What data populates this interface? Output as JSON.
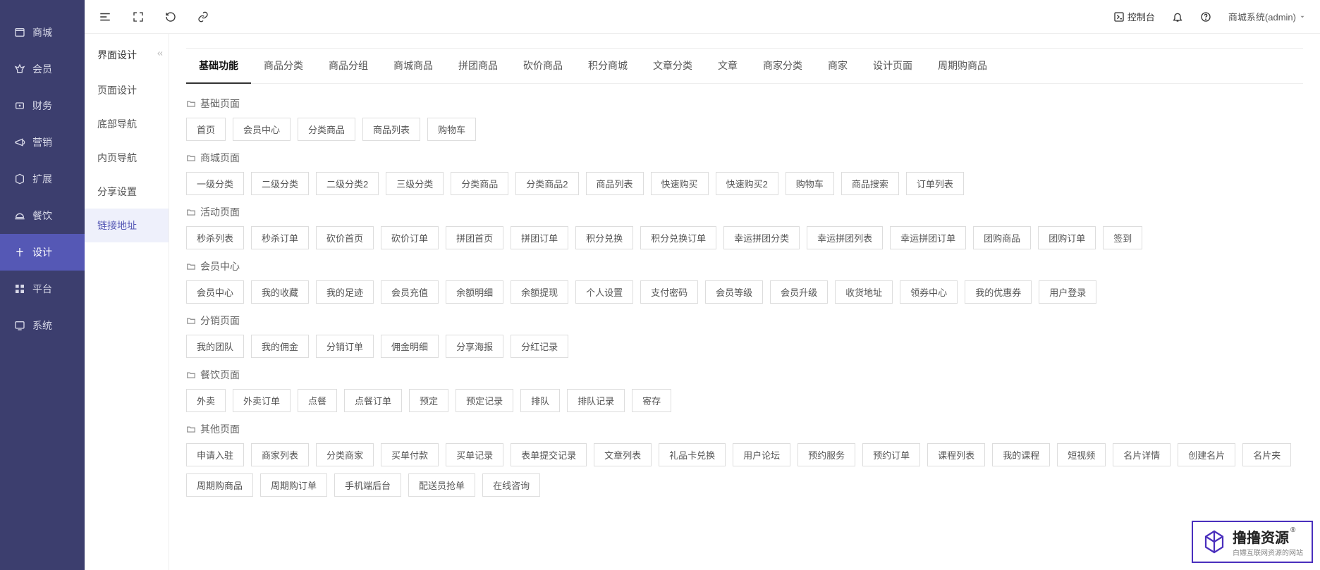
{
  "topbar": {
    "console_label": "控制台",
    "user_label": "商城系统(admin)"
  },
  "sidebar_main": {
    "items": [
      {
        "label": "商城",
        "icon": "mall-icon"
      },
      {
        "label": "会员",
        "icon": "member-icon"
      },
      {
        "label": "财务",
        "icon": "finance-icon"
      },
      {
        "label": "营销",
        "icon": "marketing-icon"
      },
      {
        "label": "扩展",
        "icon": "extension-icon"
      },
      {
        "label": "餐饮",
        "icon": "catering-icon"
      },
      {
        "label": "设计",
        "icon": "design-icon"
      },
      {
        "label": "平台",
        "icon": "platform-icon"
      },
      {
        "label": "系统",
        "icon": "system-icon"
      }
    ],
    "active_index": 6
  },
  "sidebar_sub": {
    "title": "界面设计",
    "items": [
      {
        "label": "页面设计"
      },
      {
        "label": "底部导航"
      },
      {
        "label": "内页导航"
      },
      {
        "label": "分享设置"
      },
      {
        "label": "链接地址"
      }
    ],
    "active_index": 4
  },
  "tabs": {
    "items": [
      "基础功能",
      "商品分类",
      "商品分组",
      "商城商品",
      "拼团商品",
      "砍价商品",
      "积分商城",
      "文章分类",
      "文章",
      "商家分类",
      "商家",
      "设计页面",
      "周期购商品"
    ],
    "active_index": 0
  },
  "sections": [
    {
      "title": "基础页面",
      "chips": [
        "首页",
        "会员中心",
        "分类商品",
        "商品列表",
        "购物车"
      ]
    },
    {
      "title": "商城页面",
      "chips": [
        "一级分类",
        "二级分类",
        "二级分类2",
        "三级分类",
        "分类商品",
        "分类商品2",
        "商品列表",
        "快速购买",
        "快速购买2",
        "购物车",
        "商品搜索",
        "订单列表"
      ]
    },
    {
      "title": "活动页面",
      "chips": [
        "秒杀列表",
        "秒杀订单",
        "砍价首页",
        "砍价订单",
        "拼团首页",
        "拼团订单",
        "积分兑换",
        "积分兑换订单",
        "幸运拼团分类",
        "幸运拼团列表",
        "幸运拼团订单",
        "团购商品",
        "团购订单",
        "签到"
      ]
    },
    {
      "title": "会员中心",
      "chips": [
        "会员中心",
        "我的收藏",
        "我的足迹",
        "会员充值",
        "余额明细",
        "余额提现",
        "个人设置",
        "支付密码",
        "会员等级",
        "会员升级",
        "收货地址",
        "领券中心",
        "我的优惠券",
        "用户登录"
      ]
    },
    {
      "title": "分销页面",
      "chips": [
        "我的团队",
        "我的佣金",
        "分销订单",
        "佣金明细",
        "分享海报",
        "分红记录"
      ]
    },
    {
      "title": "餐饮页面",
      "chips": [
        "外卖",
        "外卖订单",
        "点餐",
        "点餐订单",
        "预定",
        "预定记录",
        "排队",
        "排队记录",
        "寄存"
      ]
    },
    {
      "title": "其他页面",
      "chips": [
        "申请入驻",
        "商家列表",
        "分类商家",
        "买单付款",
        "买单记录",
        "表单提交记录",
        "文章列表",
        "礼品卡兑换",
        "用户论坛",
        "预约服务",
        "预约订单",
        "课程列表",
        "我的课程",
        "短视频",
        "名片详情",
        "创建名片",
        "名片夹",
        "周期购商品",
        "周期购订单",
        "手机端后台",
        "配送员抢单",
        "在线咨询"
      ]
    }
  ],
  "watermark": {
    "main": "撸撸资源",
    "sub": "白嫖互联网资源的网站",
    "reg": "®"
  }
}
